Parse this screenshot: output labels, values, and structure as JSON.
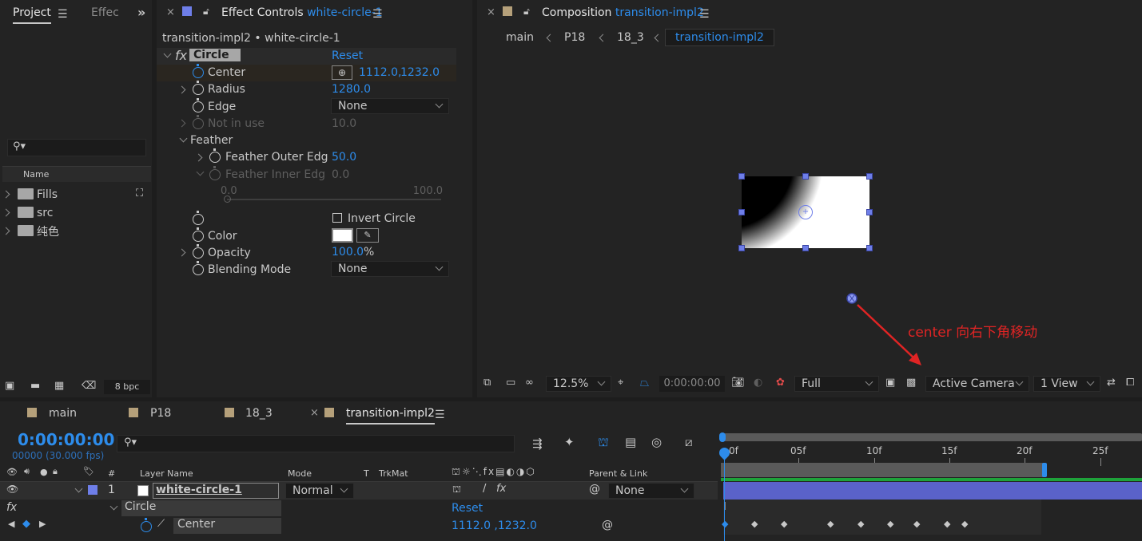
{
  "project": {
    "tab": "Project",
    "tab2": "Effec",
    "search_placeholder": "",
    "col_name": "Name",
    "items": [
      {
        "label": "Fills"
      },
      {
        "label": "src"
      },
      {
        "label": "纯色"
      }
    ],
    "bpc": "8 bpc"
  },
  "effect_controls": {
    "tab_prefix": "Effect Controls",
    "tab_layer": "white-circle-1",
    "crumb": "transition-impl2 • white-circle-1",
    "effect_name": "Circle",
    "reset": "Reset",
    "center_label": "Center",
    "center_x": "1112.0",
    "center_sep": ",",
    "center_y": "1232.0",
    "radius_label": "Radius",
    "radius_value": "1280.0",
    "edge_label": "Edge",
    "edge_value": "None",
    "notinuse_label": "Not in use",
    "notinuse_value": "10.0",
    "feather_label": "Feather",
    "feather_outer_label": "Feather Outer Edg",
    "feather_outer_value": "50.0",
    "feather_inner_label": "Feather Inner Edg",
    "feather_inner_value": "0.0",
    "slider_min": "0.0",
    "slider_max": "100.0",
    "invert_label": "Invert Circle",
    "color_label": "Color",
    "opacity_label": "Opacity",
    "opacity_value": "100.0",
    "opacity_unit": "%",
    "blend_label": "Blending Mode",
    "blend_value": "None"
  },
  "composition": {
    "tab_prefix": "Composition",
    "tab_comp": "transition-impl2",
    "crumbs": [
      "main",
      "P18",
      "18_3",
      "transition-impl2"
    ],
    "annotation": "center 向右下角移动",
    "zoom": "12.5%",
    "timecode": "0:00:00:00",
    "resolution": "Full",
    "camera": "Active Camera",
    "views": "1 View"
  },
  "timeline": {
    "tabs": [
      "main",
      "P18",
      "18_3",
      "transition-impl2"
    ],
    "timecode": "0:00:00:00",
    "fps": "00000 (30.000 fps)",
    "col_hash": "#",
    "col_layer_name": "Layer Name",
    "col_mode": "Mode",
    "col_t": "T",
    "col_trkmat": "TrkMat",
    "col_parent": "Parent & Link",
    "layer_index": "1",
    "layer_name": "white-circle-1",
    "layer_mode": "Normal",
    "layer_parent": "None",
    "fx_label": "fx",
    "effect_name": "Circle",
    "reset": "Reset",
    "center_label": "Center",
    "center_value": "1112.0 ,1232.0",
    "ruler": [
      "0f",
      "05f",
      "10f",
      "15f",
      "20f",
      "25f"
    ],
    "keyframe_count": 9
  },
  "colors": {
    "accent": "#2d8ceb",
    "handle": "#6e7ee8",
    "annotation": "#e02424",
    "layer_bar": "#5a62c9",
    "panel_bg": "#232323"
  }
}
